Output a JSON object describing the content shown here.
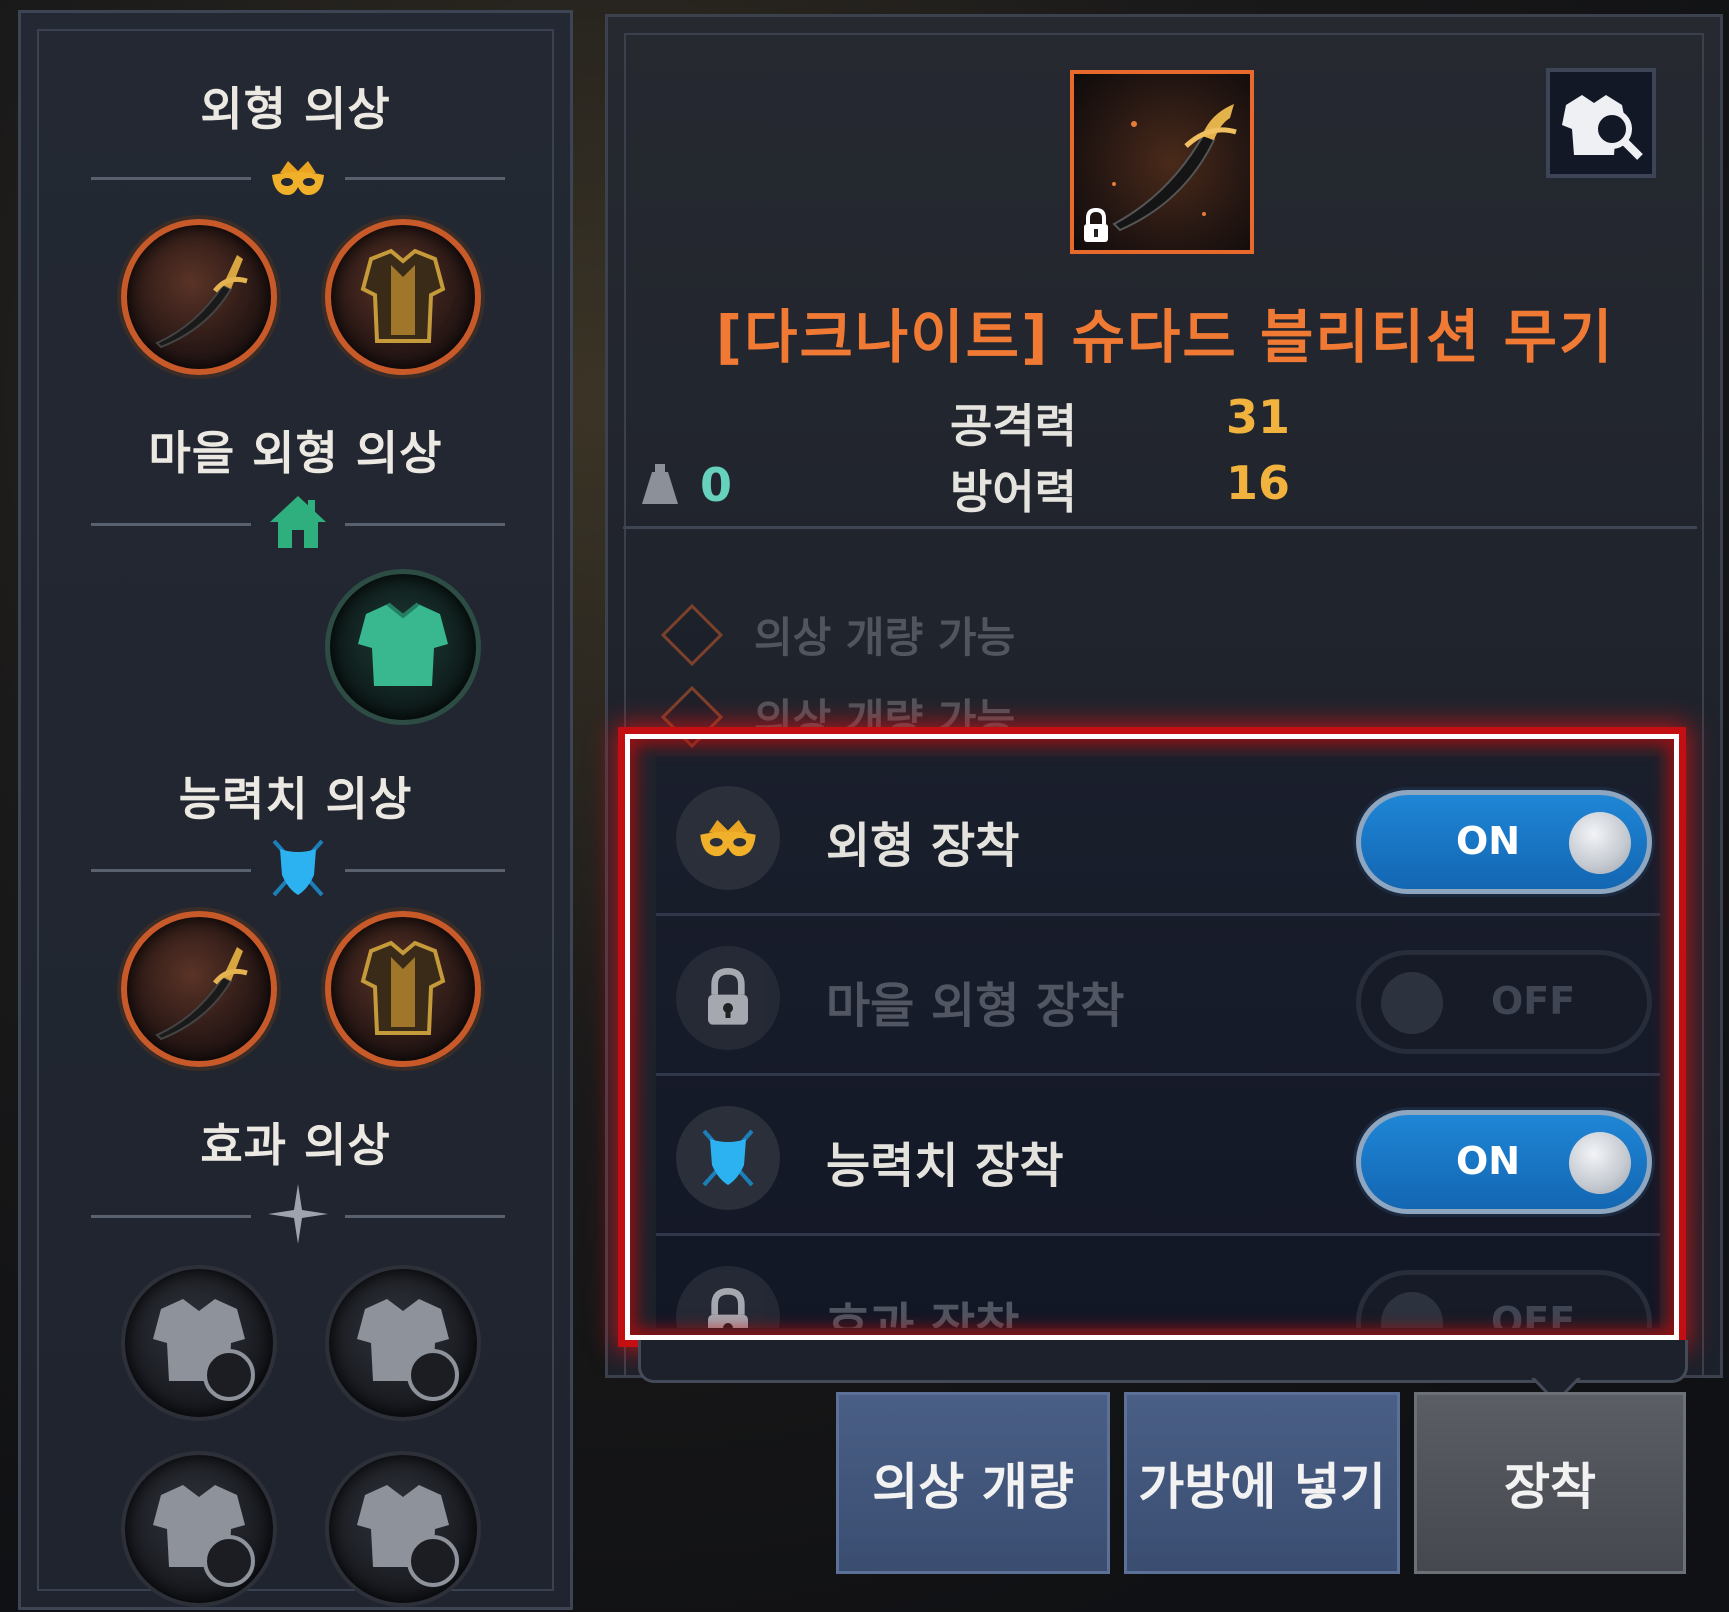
{
  "left_panel": {
    "sections": [
      {
        "title": "외형 의상",
        "icon": "crown-mask-icon"
      },
      {
        "title": "마을 외형 의상",
        "icon": "house-icon"
      },
      {
        "title": "능력치 의상",
        "icon": "shield-swords-icon"
      },
      {
        "title": "효과 의상",
        "icon": "star-icon"
      }
    ]
  },
  "item": {
    "name": "[다크나이트] 슈다드 블리티션 무기",
    "lock_icon": "lock-icon",
    "stats": [
      {
        "label": "공격력",
        "value": "31"
      },
      {
        "label": "방어력",
        "value": "16"
      }
    ],
    "weight": "0"
  },
  "hidden_rows": [
    "의상 개량 가능",
    "의상 개량 가능"
  ],
  "toggles": [
    {
      "label": "외형 장착",
      "state": "ON",
      "enabled": true,
      "icon": "crown-mask-icon"
    },
    {
      "label": "마을 외형 장착",
      "state": "OFF",
      "enabled": false,
      "icon": "lock-icon"
    },
    {
      "label": "능력치 장착",
      "state": "ON",
      "enabled": true,
      "icon": "shield-swords-icon"
    },
    {
      "label": "효과 장착",
      "state": "OFF",
      "enabled": false,
      "icon": "lock-icon"
    }
  ],
  "buttons": {
    "upgrade": "의상 개량",
    "to_bag": "가방에 넣기",
    "equip": "장착"
  },
  "colors": {
    "item_name": "#f07a34",
    "stat_value": "#f2b33e",
    "weight_value": "#67d1bd",
    "toggle_on": "#1f86d6",
    "highlight": "#c40f12"
  }
}
